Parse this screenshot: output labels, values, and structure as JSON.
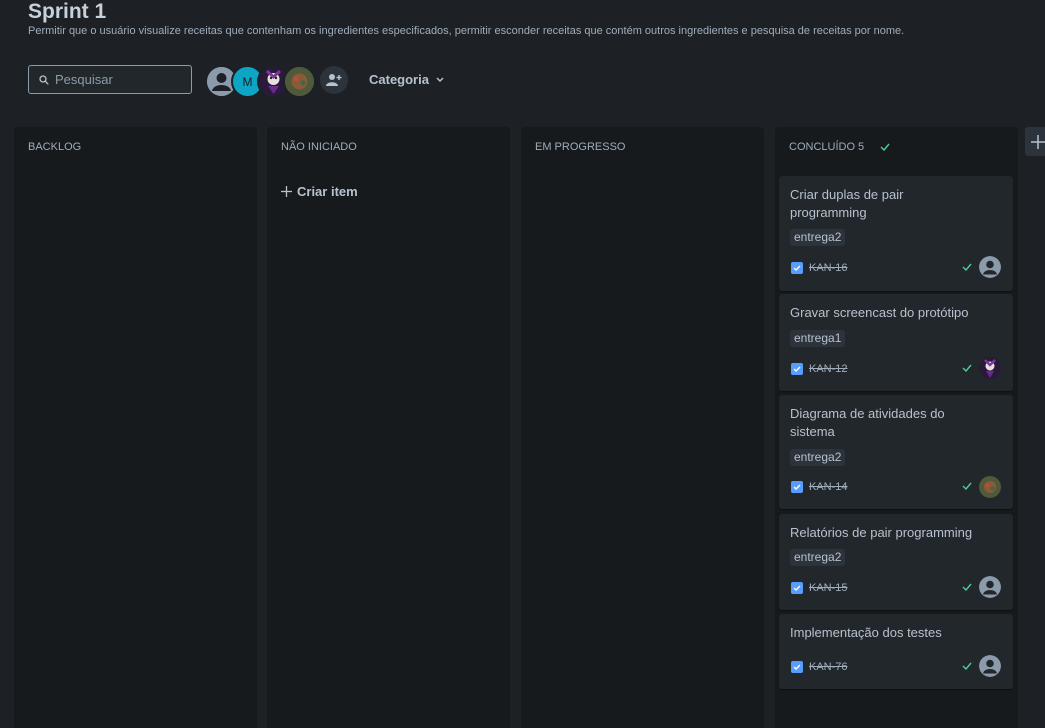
{
  "page": {
    "title": "Sprint 1",
    "subtitle": "Permitir que o usuário visualize receitas que contenham os ingredientes especificados, permitir esconder receitas que contém outros ingredientes e pesquisa de receitas por nome."
  },
  "toolbar": {
    "search_placeholder": "Pesquisar",
    "avatar_initial": "M",
    "category_label": "Categoria"
  },
  "columns": [
    {
      "title": "BACKLOG"
    },
    {
      "title": "NÃO INICIADO",
      "create_label": "Criar item"
    },
    {
      "title": "EM PROGRESSO"
    },
    {
      "title": "CONCLUÍDO 5"
    }
  ],
  "cards": [
    {
      "title": "Criar duplas de pair programming",
      "tag": "entrega2",
      "key": "KAN-16",
      "assignee": "default-avatar-icon"
    },
    {
      "title": "Gravar screencast do protótipo",
      "tag": "entrega1",
      "key": "KAN-12",
      "assignee": "user-photo-avatar"
    },
    {
      "title": "Diagrama de atividades do sistema",
      "tag": "entrega2",
      "key": "KAN-14",
      "assignee": "user-photo-avatar"
    },
    {
      "title": "Relatórios de pair programming",
      "tag": "entrega2",
      "key": "KAN-15",
      "assignee": "default-avatar-icon"
    },
    {
      "title": "Implementação dos testes",
      "key": "KAN-76",
      "assignee": "default-avatar-icon"
    }
  ],
  "colors": {
    "background": "#1d2125",
    "column": "#161a1d",
    "card": "#22272b",
    "checkbox": "#579dff",
    "done_check": "#4bce97"
  }
}
